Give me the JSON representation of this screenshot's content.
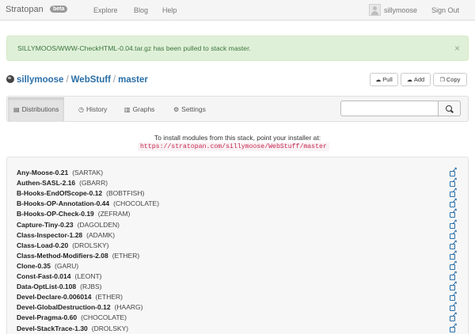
{
  "navbar": {
    "brand": "Stratopan",
    "badge": "beta",
    "links": [
      "Explore",
      "Blog",
      "Help"
    ],
    "username": "sillymoose",
    "sign_out": "Sign Out"
  },
  "alert": {
    "message": "SILLYMOOS/WWW-CheckHTML-0.04.tar.gz has been pulled to stack master.",
    "close": "×"
  },
  "breadcrumb": {
    "user": "sillymoose",
    "repo": "WebStuff",
    "stack": "master",
    "separator": "/"
  },
  "actions": {
    "pull": "Pull",
    "add": "Add",
    "copy": "Copy"
  },
  "tabs": {
    "distributions": "Distributions",
    "history": "History",
    "graphs": "Graphs",
    "settings": "Settings"
  },
  "search": {
    "value": "",
    "placeholder": ""
  },
  "install": {
    "text": "To install modules from this stack, point your installer at:",
    "url": "https://stratopan.com/sillymoose/WebStuff/master"
  },
  "distributions": [
    {
      "name": "Any-Moose-0.21",
      "author": "(SARTAK)"
    },
    {
      "name": "Authen-SASL-2.16",
      "author": "(GBARR)"
    },
    {
      "name": "B-Hooks-EndOfScope-0.12",
      "author": "(BOBTFISH)"
    },
    {
      "name": "B-Hooks-OP-Annotation-0.44",
      "author": "(CHOCOLATE)"
    },
    {
      "name": "B-Hooks-OP-Check-0.19",
      "author": "(ZEFRAM)"
    },
    {
      "name": "Capture-Tiny-0.23",
      "author": "(DAGOLDEN)"
    },
    {
      "name": "Class-Inspector-1.28",
      "author": "(ADAMK)"
    },
    {
      "name": "Class-Load-0.20",
      "author": "(DROLSKY)"
    },
    {
      "name": "Class-Method-Modifiers-2.08",
      "author": "(ETHER)"
    },
    {
      "name": "Clone-0.35",
      "author": "(GARU)"
    },
    {
      "name": "Const-Fast-0.014",
      "author": "(LEONT)"
    },
    {
      "name": "Data-OptList-0.108",
      "author": "(RJBS)"
    },
    {
      "name": "Devel-Declare-0.006014",
      "author": "(ETHER)"
    },
    {
      "name": "Devel-GlobalDestruction-0.12",
      "author": "(HAARG)"
    },
    {
      "name": "Devel-Pragma-0.60",
      "author": "(CHOCOLATE)"
    },
    {
      "name": "Devel-StackTrace-1.30",
      "author": "(DROLSKY)"
    }
  ]
}
